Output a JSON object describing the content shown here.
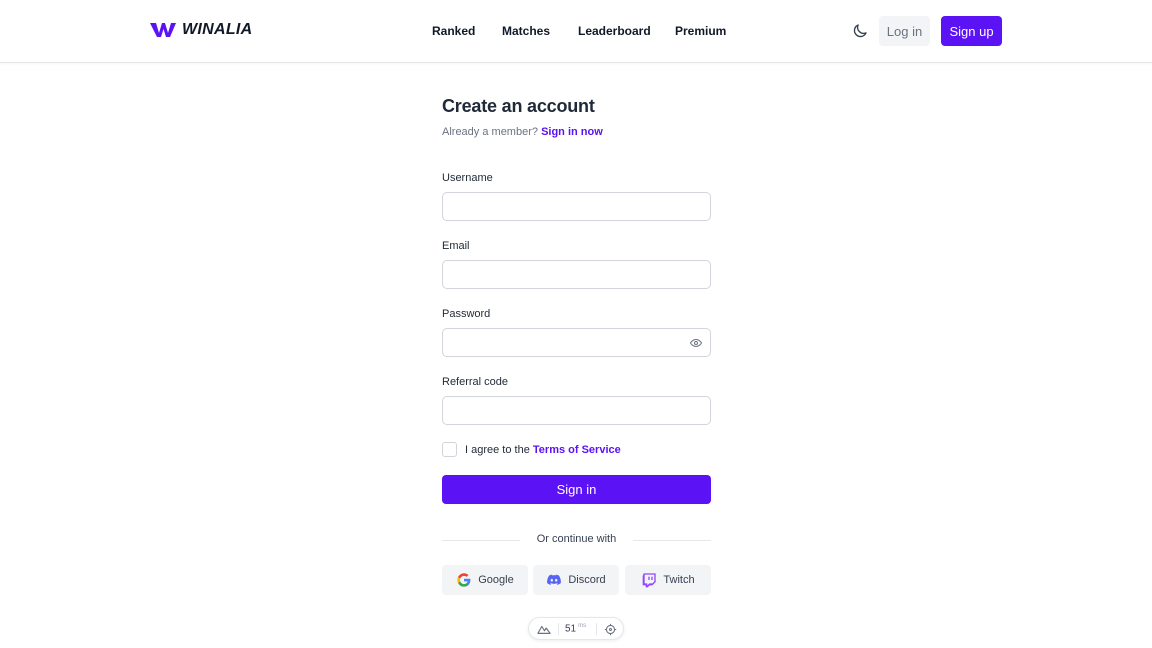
{
  "brand": {
    "name": "WINALIA",
    "accent": "#5b12f5"
  },
  "nav": {
    "items": [
      "Ranked",
      "Matches",
      "Leaderboard",
      "Premium"
    ]
  },
  "header": {
    "login_label": "Log in",
    "signup_label": "Sign up",
    "theme_icon": "moon-icon"
  },
  "form": {
    "title": "Create an account",
    "member_prompt": "Already a member?",
    "signin_link": "Sign in now",
    "fields": {
      "username": {
        "label": "Username",
        "value": ""
      },
      "email": {
        "label": "Email",
        "value": ""
      },
      "password": {
        "label": "Password",
        "value": ""
      },
      "referral": {
        "label": "Referral code",
        "value": ""
      }
    },
    "agree_prefix": "I agree to the",
    "terms_link": "Terms of Service",
    "agree_checked": false,
    "submit_label": "Sign in",
    "divider_text": "Or continue with",
    "socials": [
      "Google",
      "Discord",
      "Twitch"
    ]
  },
  "status": {
    "ping_value": "51",
    "ping_unit": "ms"
  }
}
